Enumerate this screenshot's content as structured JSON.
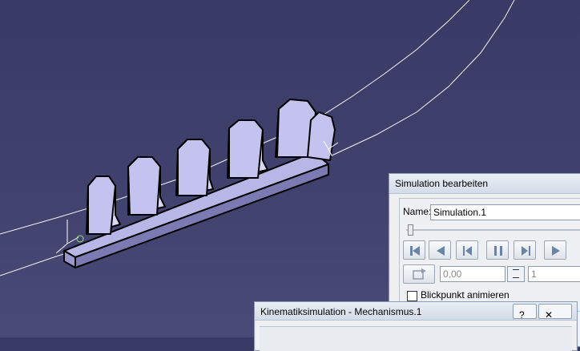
{
  "viewport": {
    "background_color": "#41416e",
    "part_color": "#c9c8f0",
    "curve_color": "#f2f2f2"
  },
  "simulation_dialog": {
    "title": "Simulation bearbeiten",
    "name_label": "Name:",
    "name_value": "Simulation.1",
    "slider_icon": "slider-thumb",
    "player_buttons": [
      {
        "name": "skip-to-start-icon"
      },
      {
        "name": "play-backward-icon"
      },
      {
        "name": "step-backward-icon"
      },
      {
        "name": "pause-icon"
      },
      {
        "name": "step-forward-icon"
      },
      {
        "name": "play-forward-icon"
      }
    ],
    "time_value": "0,00",
    "step_value": "1",
    "animate_viewpoint_label": "Blickpunkt animieren",
    "animate_viewpoint_checked": false
  },
  "kinematics_dialog": {
    "title": "Kinematiksimulation - Mechanismus.1",
    "help_icon": "?",
    "close_icon": "✕"
  }
}
